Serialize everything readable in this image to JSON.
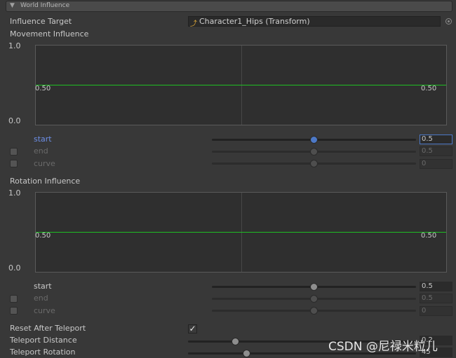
{
  "header": {
    "title": "World Influence"
  },
  "influence_target": {
    "label": "Influence Target",
    "value": "Character1_Hips (Transform)"
  },
  "movement": {
    "title": "Movement Influence",
    "axis_max": "1.0",
    "axis_min": "0.0",
    "curve_left": "0.50",
    "curve_right": "0.50",
    "rows": [
      {
        "label": "start",
        "value": "0.5"
      },
      {
        "label": "end",
        "value": "0.5"
      },
      {
        "label": "curve",
        "value": "0"
      }
    ]
  },
  "rotation": {
    "title": "Rotation Influence",
    "axis_max": "1.0",
    "axis_min": "0.0",
    "curve_left": "0.50",
    "curve_right": "0.50",
    "rows": [
      {
        "label": "start",
        "value": "0.5"
      },
      {
        "label": "end",
        "value": "0.5"
      },
      {
        "label": "curve",
        "value": "0"
      }
    ]
  },
  "reset_after_teleport": {
    "label": "Reset After Teleport",
    "checked": true
  },
  "teleport_distance": {
    "label": "Teleport Distance",
    "value": "0.2"
  },
  "teleport_rotation": {
    "label": "Teleport Rotation",
    "value": "45"
  },
  "watermark": "CSDN @尼禄米粒儿",
  "icons": [
    "foldout-arrow-icon",
    "transform-icon",
    "object-picker-icon",
    "checkmark-icon"
  ]
}
